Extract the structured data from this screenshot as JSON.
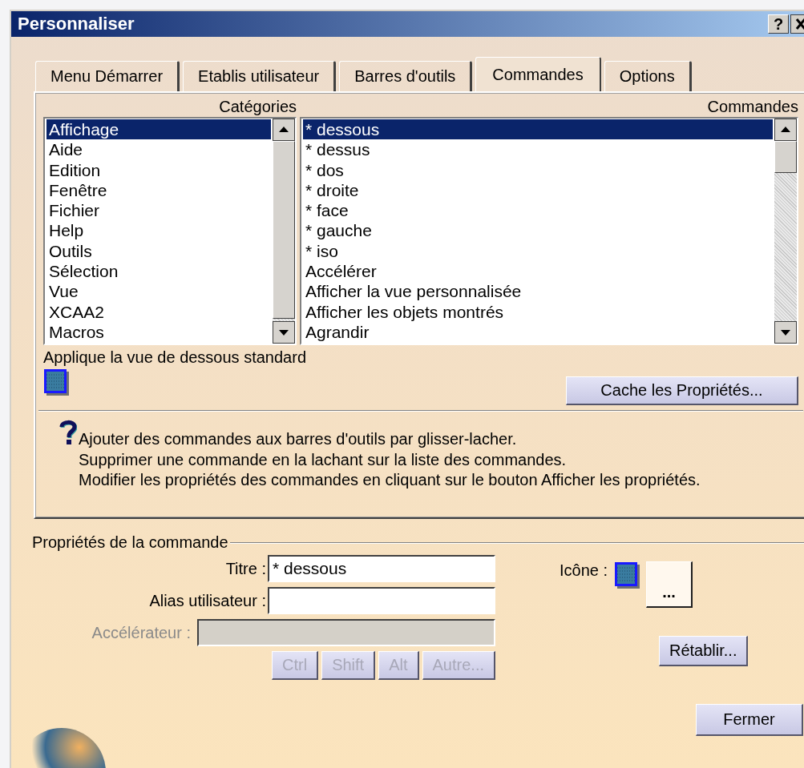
{
  "window": {
    "title": "Personnaliser",
    "help_button": "?"
  },
  "tabs": [
    {
      "label": "Menu Démarrer",
      "selected": false
    },
    {
      "label": "Etablis utilisateur",
      "selected": false
    },
    {
      "label": "Barres d'outils",
      "selected": false
    },
    {
      "label": "Commandes",
      "selected": true
    },
    {
      "label": "Options",
      "selected": false
    }
  ],
  "categories": {
    "heading": "Catégories",
    "items": [
      {
        "label": "Affichage",
        "selected": true
      },
      {
        "label": "Aide",
        "selected": false
      },
      {
        "label": "Edition",
        "selected": false
      },
      {
        "label": "Fenêtre",
        "selected": false
      },
      {
        "label": "Fichier",
        "selected": false
      },
      {
        "label": "Help",
        "selected": false
      },
      {
        "label": "Outils",
        "selected": false
      },
      {
        "label": "Sélection",
        "selected": false
      },
      {
        "label": "Vue",
        "selected": false
      },
      {
        "label": "XCAA2",
        "selected": false
      },
      {
        "label": "Macros",
        "selected": false
      }
    ]
  },
  "commands": {
    "heading": "Commandes",
    "items": [
      {
        "label": "* dessous",
        "selected": true
      },
      {
        "label": "* dessus",
        "selected": false
      },
      {
        "label": "* dos",
        "selected": false
      },
      {
        "label": "* droite",
        "selected": false
      },
      {
        "label": "* face",
        "selected": false
      },
      {
        "label": "* gauche",
        "selected": false
      },
      {
        "label": "* iso",
        "selected": false
      },
      {
        "label": "Accélérer",
        "selected": false
      },
      {
        "label": "Afficher la vue personnalisée",
        "selected": false
      },
      {
        "label": "Afficher les objets montrés",
        "selected": false
      },
      {
        "label": "Agrandir",
        "selected": false
      }
    ]
  },
  "description": "Applique la vue de dessous standard",
  "hide_properties_button": "Cache les Propriétés...",
  "help_lines": [
    "Ajouter des commandes aux barres d'outils par glisser-lacher.",
    "Supprimer une commande en la lachant sur la liste des commandes.",
    "Modifier les propriétés des commandes en cliquant sur le bouton Afficher les propriétés."
  ],
  "properties": {
    "legend": "Propriétés de la commande",
    "title_label": "Titre :",
    "title_value": "* dessous",
    "alias_label": "Alias utilisateur :",
    "accelerator_label": "Accélérateur :",
    "accelerator_disabled": true,
    "modifiers": [
      {
        "label": "Ctrl",
        "disabled": true
      },
      {
        "label": "Shift",
        "disabled": true
      },
      {
        "label": "Alt",
        "disabled": true
      },
      {
        "label": "Autre...",
        "disabled": true
      }
    ],
    "icon_label": "Icône :",
    "icon_browse_button": "...",
    "reset_button": "Rétablir..."
  },
  "close_button": "Fermer"
}
